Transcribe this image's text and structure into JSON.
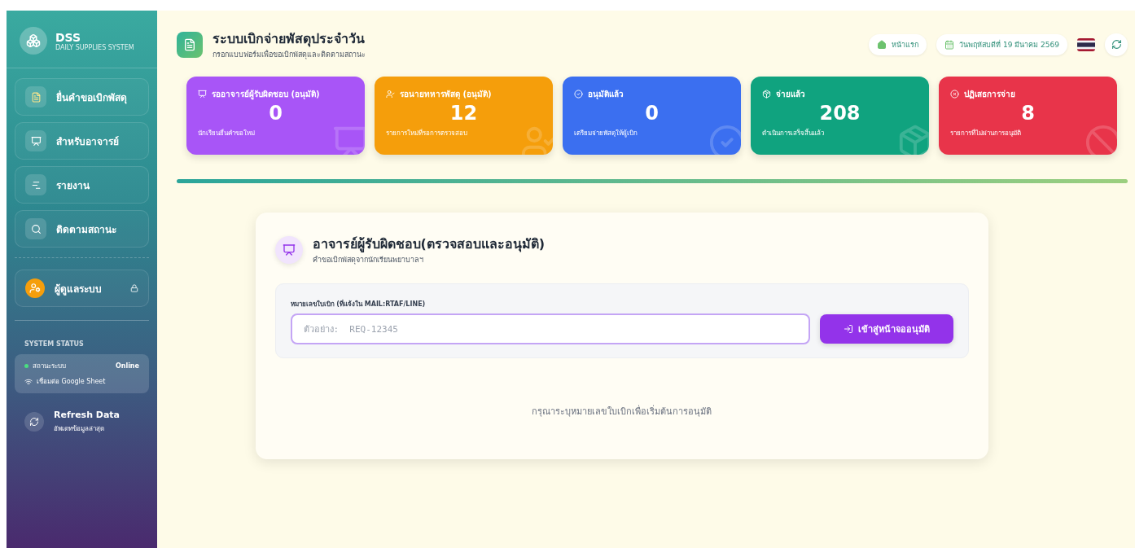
{
  "sidebar": {
    "logo": {
      "title": "DSS",
      "subtitle": "DAILY SUPPLIES SYSTEM"
    },
    "menu": [
      {
        "kind": "request",
        "label": "ยื่นคำขอเบิกพัสดุ",
        "selected": false
      },
      {
        "kind": "teacher",
        "label": "สำหรับอาจารย์",
        "selected": false
      },
      {
        "kind": "report",
        "label": "รายงาน",
        "selected": false
      },
      {
        "kind": "track",
        "label": "ติดตามสถานะ",
        "selected": false
      }
    ],
    "admin": {
      "label": "ผู้ดูแลระบบ",
      "locked": true
    },
    "status_heading": "SYSTEM STATUS",
    "status": {
      "label": "สถานะระบบ",
      "value": "Online",
      "online": true,
      "connection": "เชื่อมต่อ Google Sheet"
    },
    "refresh": {
      "title": "Refresh Data",
      "subtitle": "อัพเดทข้อมูลล่าสุด"
    }
  },
  "header": {
    "title": "ระบบเบิกจ่ายพัสดุประจำวัน",
    "subtitle": "กรอกแบบฟอร์มเพื่อขอเบิกพัสดุและติดตามสถานะ",
    "home": "หน้าแรก",
    "date": "วันพฤหัสบดีที่ 19 มีนาคม 2569"
  },
  "stats": [
    {
      "kind": "teacher",
      "title": "รออาจารย์ผู้รับผิดชอบ (อนุมัติ)",
      "value": "0",
      "note": "นักเรียนยื่นคำขอใหม่",
      "color": "#a855f7"
    },
    {
      "kind": "officer",
      "title": "รอนายทหารพัสดุ (อนุมัติ)",
      "value": "12",
      "note": "รายการใหม่ที่รอการตรวจสอบ",
      "color": "#f59e0b"
    },
    {
      "kind": "approved",
      "title": "อนุมัติแล้ว",
      "value": "0",
      "note": "เตรียมจ่ายพัสดุให้ผู้เบิก",
      "color": "#3b6ff0"
    },
    {
      "kind": "paid",
      "title": "จ่ายแล้ว",
      "value": "208",
      "note": "ดำเนินการเสร็จสิ้นแล้ว",
      "color": "#10a37f"
    },
    {
      "kind": "rejected",
      "title": "ปฏิเสธการจ่าย",
      "value": "8",
      "note": "รายการที่ไม่ผ่านการอนุมัติ",
      "color": "#e8344a"
    }
  ],
  "panel": {
    "title": "อาจารย์ผู้รับผิดชอบ(ตรวจสอบและอนุมัติ)",
    "subtitle": "คำขอเบิกพัสดุจากนักเรียนพยาบาลฯ",
    "field_label": "หมายเลขใบเบิก (ที่แจ้งใน MAIL:RTAF/LINE)",
    "placeholder": "ตัวอย่าง:  REQ-12345",
    "button": "เข้าสู่หน้าจออนุมัติ",
    "hint": "กรุณาระบุหมายเลขใบเบิกเพื่อเริ่มต้นการอนุมัติ"
  }
}
